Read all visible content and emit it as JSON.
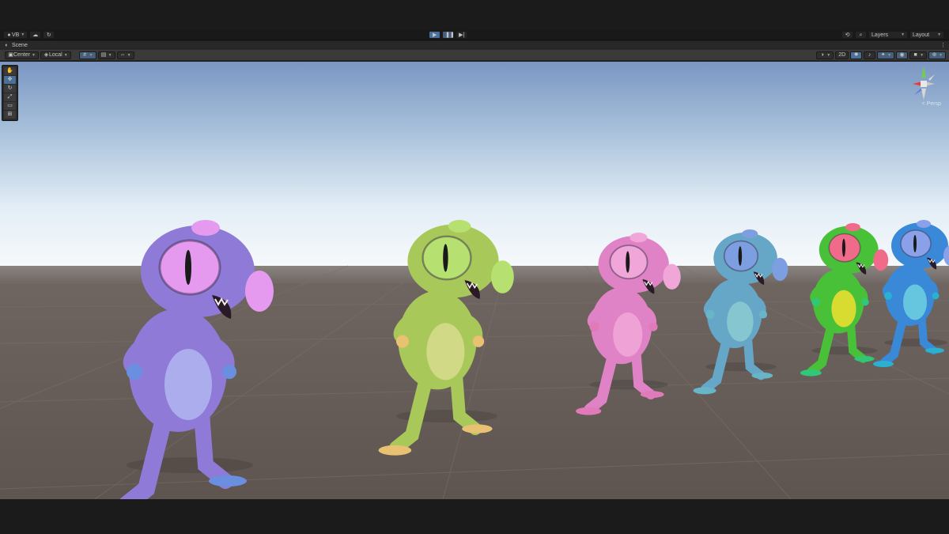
{
  "toolbar": {
    "account_label": "VB",
    "layers_label": "Layers",
    "layout_label": "Layout",
    "play_icon": "play-icon",
    "pause_icon": "pause-icon",
    "step_icon": "step-icon"
  },
  "scene_tab": {
    "label": "Scene"
  },
  "scene_toolbar": {
    "pivot_label": "Center",
    "space_label": "Local",
    "mode_2d_label": "2D"
  },
  "gizmo": {
    "persp_label": "< Persp",
    "axes": [
      "x",
      "y",
      "z"
    ]
  },
  "tools": [
    "hand",
    "move",
    "rotate",
    "scale",
    "rect",
    "transform"
  ],
  "aliens": [
    {
      "color": "#8f7ad8",
      "belly": "#b0b6f0",
      "eye": "#e59af0",
      "hands": "#6a8fe0"
    },
    {
      "color": "#a9c85a",
      "belly": "#d8dc8e",
      "eye": "#b6e070",
      "hands": "#e8c272"
    },
    {
      "color": "#e082c6",
      "belly": "#f0a8d8",
      "eye": "#f0a6d8",
      "hands": "#e07ab8"
    },
    {
      "color": "#66a6c6",
      "belly": "#8ccbd2",
      "eye": "#7e9ee2",
      "hands": "#68b4c8"
    },
    {
      "color": "#48c038",
      "belly": "#f2e030",
      "eye": "#f06a8a",
      "hands": "#30c878"
    },
    {
      "color": "#3a88d8",
      "belly": "#6fd0e0",
      "eye": "#8aa0e8",
      "hands": "#2ab0d0"
    }
  ],
  "colors": {
    "sky_top": "#7b96c3",
    "sky_horizon": "#f4f8fb",
    "ground": "#625955"
  }
}
